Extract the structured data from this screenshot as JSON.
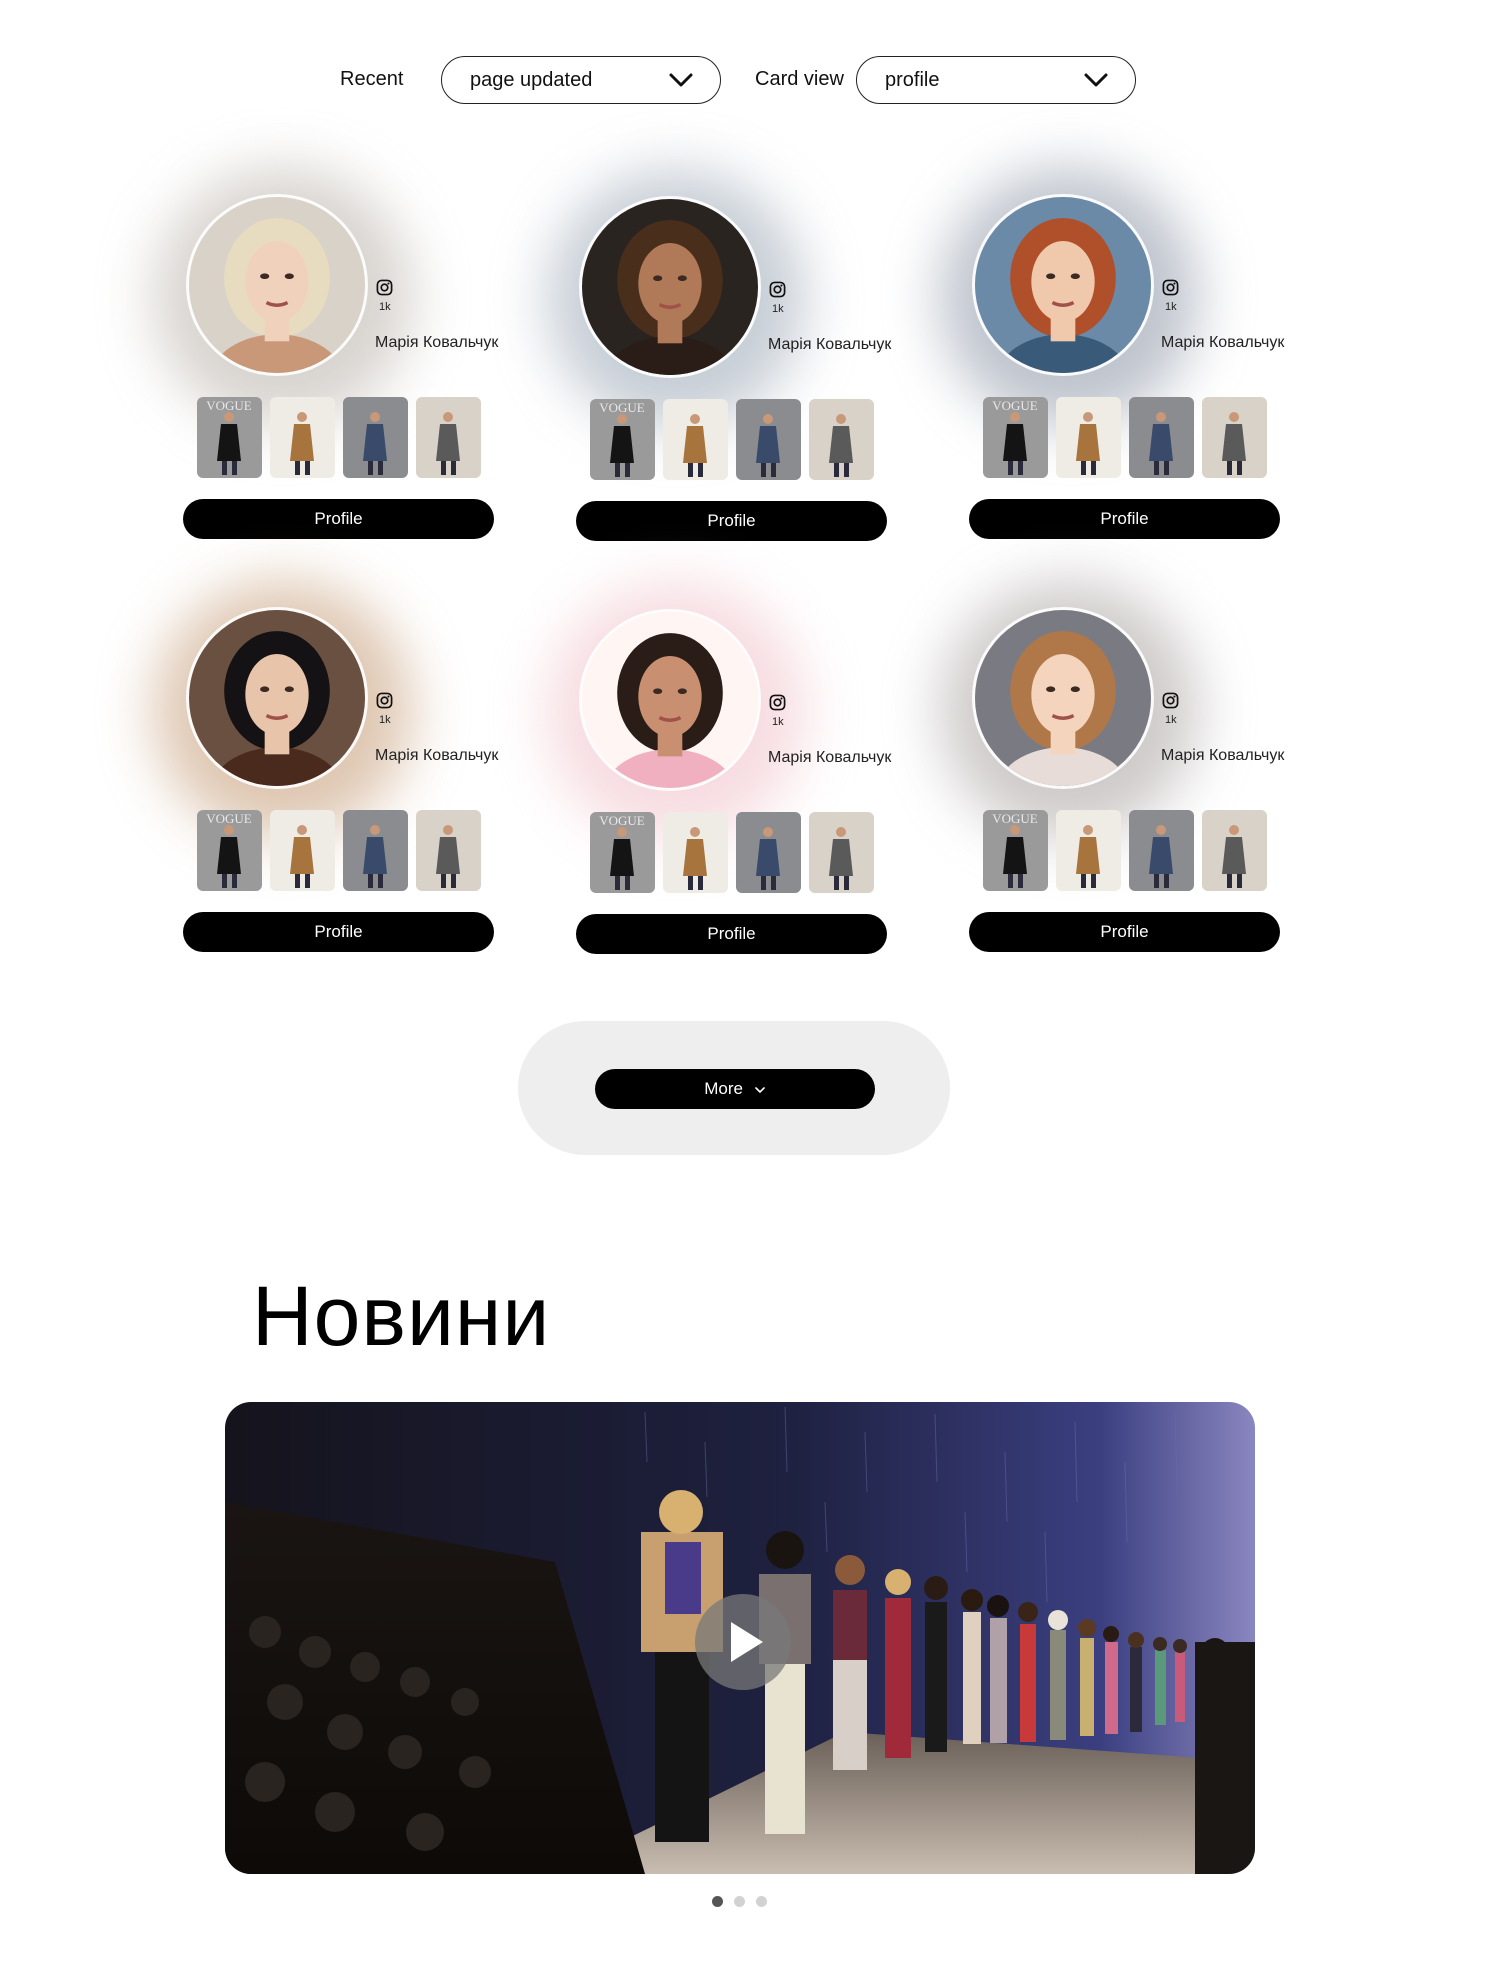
{
  "filters": {
    "recent_label": "Recent",
    "recent_value": "page updated",
    "card_view_label": "Card view",
    "card_view_value": "profile"
  },
  "cards": [
    {
      "instagram_count": "1k",
      "name": "Марія Ковальчук",
      "button_label": "Profile",
      "glow_color": "#b8b0a8"
    },
    {
      "instagram_count": "1k",
      "name": "Марія Ковальчук",
      "button_label": "Profile",
      "glow_color": "#9aa6b4"
    },
    {
      "instagram_count": "1k",
      "name": "Марія Ковальчук",
      "button_label": "Profile",
      "glow_color": "#8a94a4"
    },
    {
      "instagram_count": "1k",
      "name": "Марія Ковальчук",
      "button_label": "Profile",
      "glow_color": "#c49a74"
    },
    {
      "instagram_count": "1k",
      "name": "Марія Ковальчук",
      "button_label": "Profile",
      "glow_color": "#f0c0c8"
    },
    {
      "instagram_count": "1k",
      "name": "Марія Ковальчук",
      "button_label": "Profile",
      "glow_color": "#a8a0a0"
    }
  ],
  "thumbnail_labels": [
    "VOGUE",
    "",
    "",
    ""
  ],
  "more": {
    "label": "More"
  },
  "news": {
    "title": "Новини",
    "slides": 3,
    "active_slide": 1
  },
  "icons": [
    "chevron-down-icon",
    "instagram-icon",
    "play-icon"
  ]
}
